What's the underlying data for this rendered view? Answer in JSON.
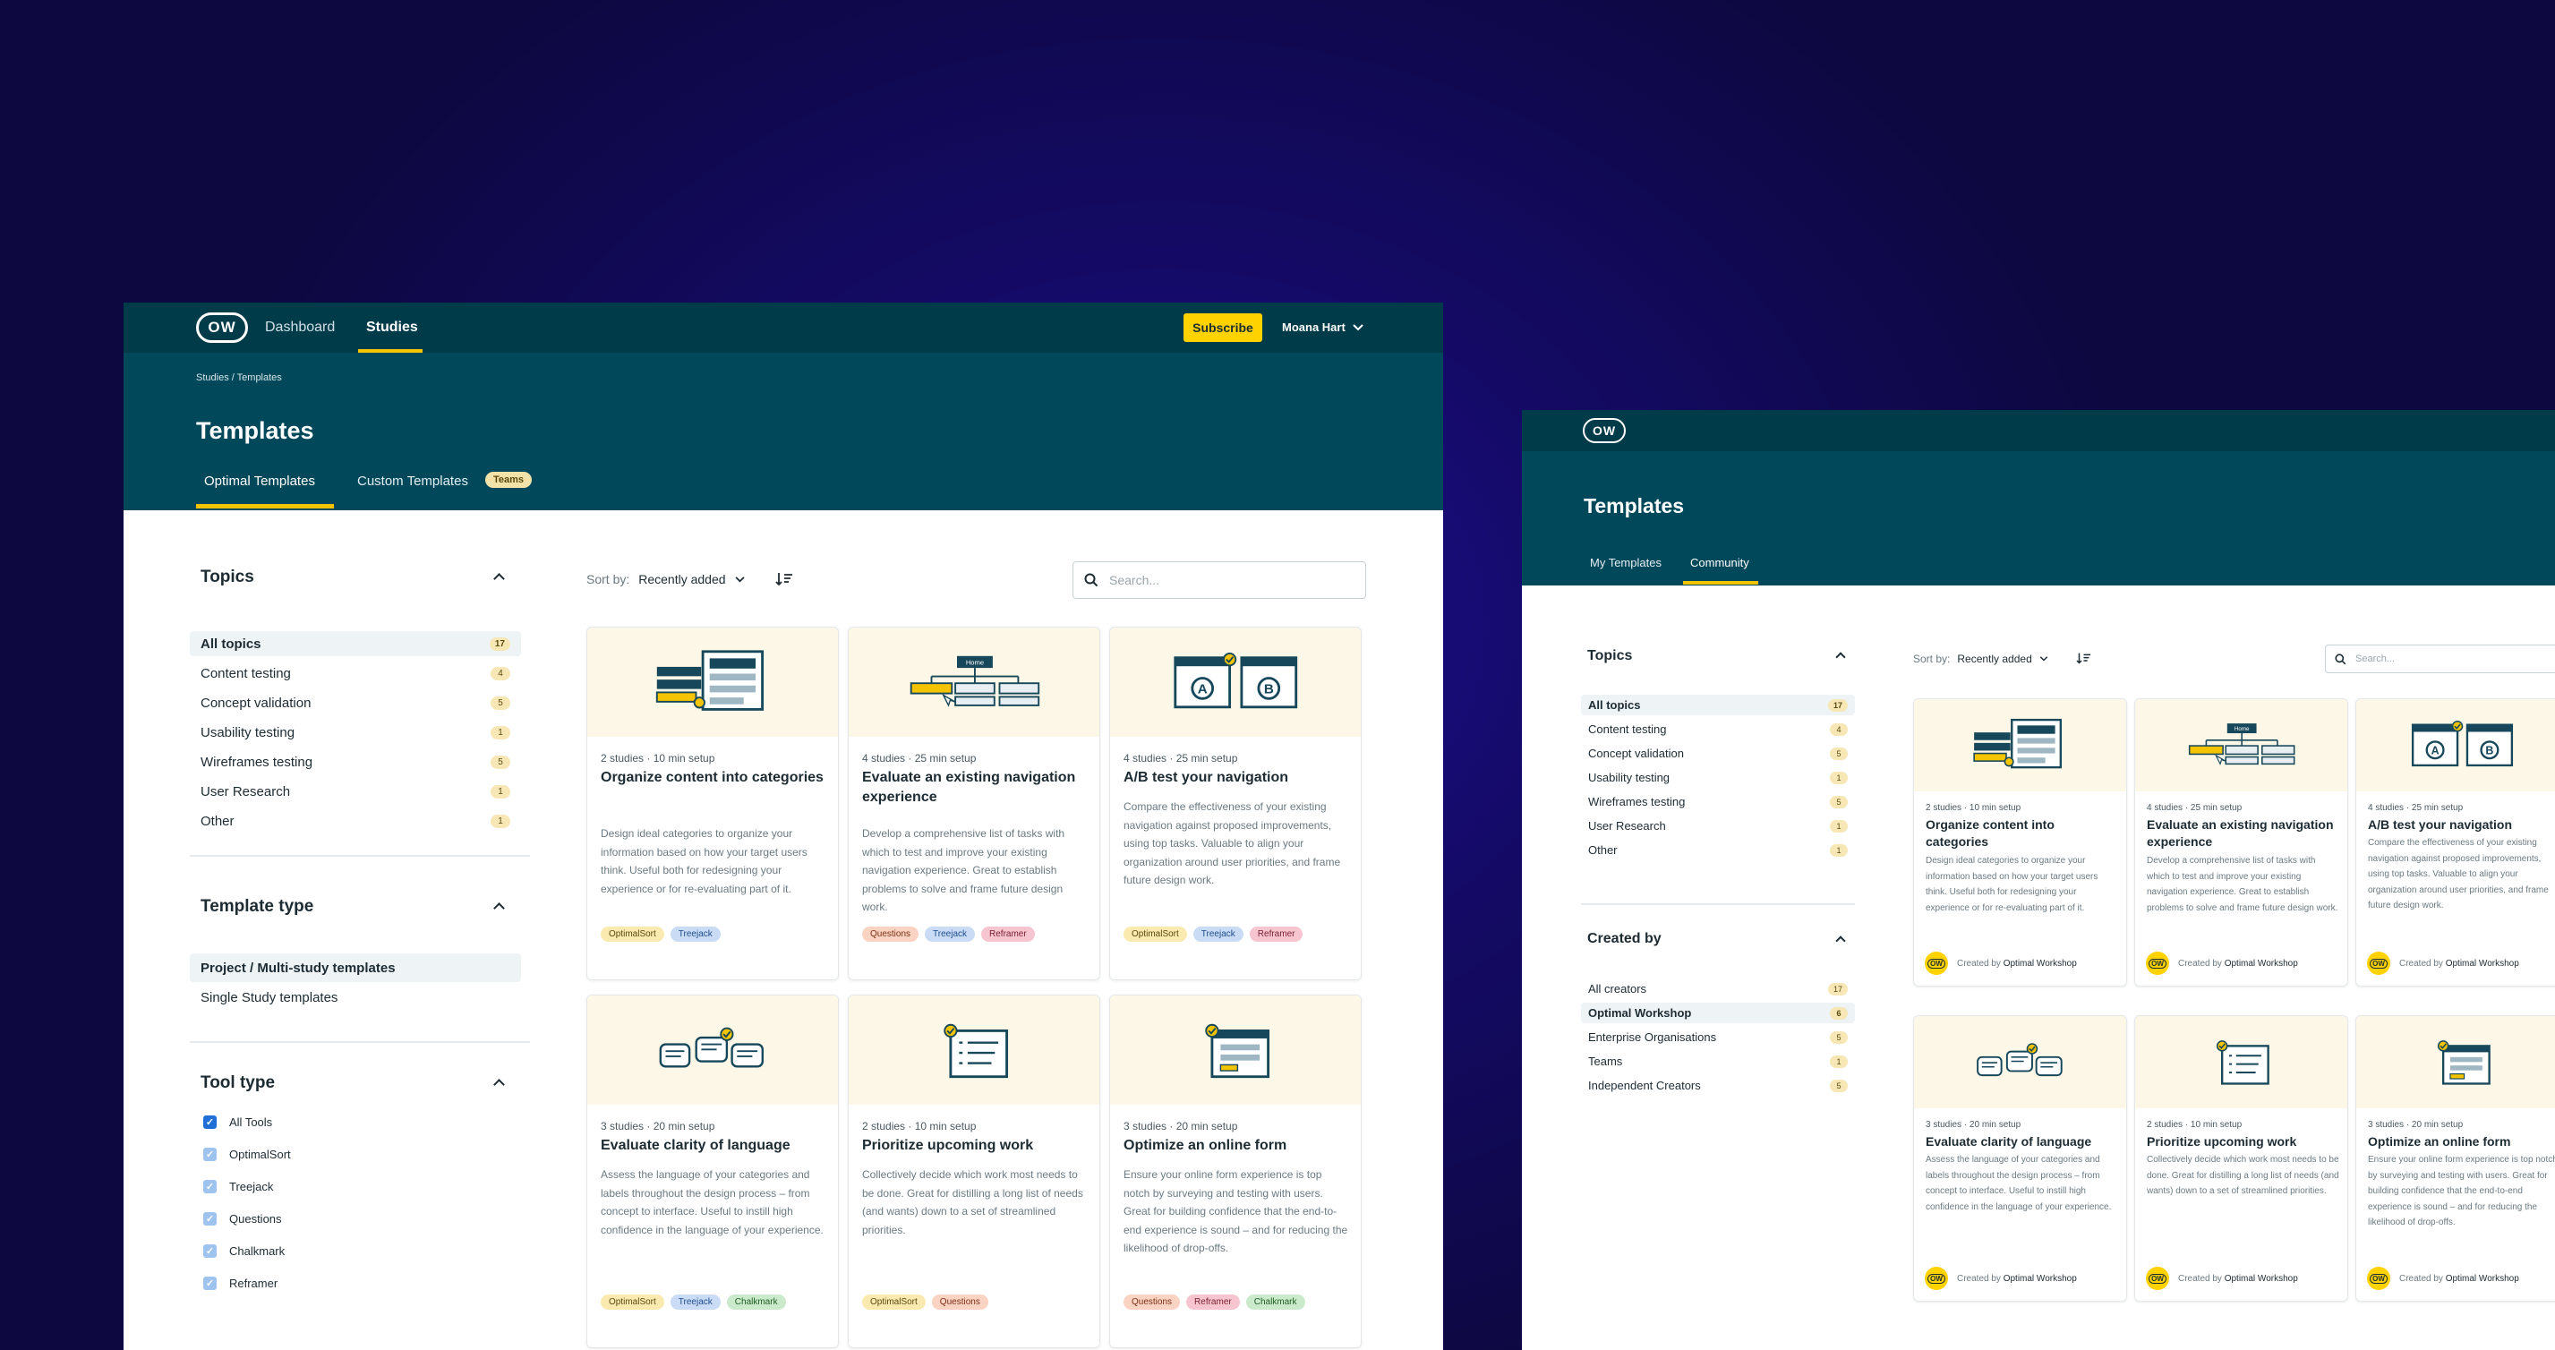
{
  "main_window": {
    "logo": "OW",
    "nav": {
      "dashboard": "Dashboard",
      "studies": "Studies"
    },
    "subscribe_label": "Subscribe",
    "user_name": "Moana Hart",
    "breadcrumb": "Studies / Templates",
    "page_title": "Templates",
    "tabs": {
      "optimal": "Optimal Templates",
      "custom": "Custom Templates",
      "custom_badge": "Teams"
    },
    "sidebar": {
      "topics_title": "Topics",
      "topics": [
        {
          "label": "All topics",
          "count": "17"
        },
        {
          "label": "Content testing",
          "count": "4"
        },
        {
          "label": "Concept validation",
          "count": "5"
        },
        {
          "label": "Usability testing",
          "count": "1"
        },
        {
          "label": "Wireframes testing",
          "count": "5"
        },
        {
          "label": "User Research",
          "count": "1"
        },
        {
          "label": "Other",
          "count": "1"
        }
      ],
      "template_type_title": "Template type",
      "template_types": [
        "Project / Multi-study templates",
        "Single Study templates"
      ],
      "tool_type_title": "Tool type",
      "tools": [
        "All Tools",
        "OptimalSort",
        "Treejack",
        "Questions",
        "Chalkmark",
        "Reframer"
      ]
    },
    "sort": {
      "label": "Sort by:",
      "value": "Recently added"
    },
    "search_placeholder": "Search...",
    "cards": [
      {
        "meta": "2 studies · 10 min setup",
        "title": "Organize content into categories",
        "desc": "Design ideal categories to organize your information based on how your target users think. Useful both for redesigning your experience or for re-evaluating part of it.",
        "tags": [
          "OptimalSort",
          "Treejack"
        ]
      },
      {
        "meta": "4 studies · 25 min setup",
        "title": "Evaluate an existing navigation experience",
        "desc": "Develop a comprehensive list of tasks with which to test and improve your existing navigation experience. Great to establish problems to solve and frame future design work.",
        "tags": [
          "Questions",
          "Treejack",
          "Reframer"
        ]
      },
      {
        "meta": "4 studies · 25 min setup",
        "title": "A/B test your navigation",
        "desc": "Compare the effectiveness of your existing navigation against proposed improvements, using top tasks. Valuable to align your organization around user priorities, and frame future design work.",
        "tags": [
          "OptimalSort",
          "Treejack",
          "Reframer"
        ]
      },
      {
        "meta": "3 studies · 20 min setup",
        "title": "Evaluate clarity of language",
        "desc": "Assess the language of your categories and labels throughout the design process – from concept to interface. Useful to instill high confidence in the language of your experience.",
        "tags": [
          "OptimalSort",
          "Treejack",
          "Chalkmark"
        ]
      },
      {
        "meta": "2 studies · 10 min setup",
        "title": "Prioritize upcoming work",
        "desc": "Collectively decide which work most needs to be done. Great for distilling a long list of needs (and wants) down to a set of streamlined priorities.",
        "tags": [
          "OptimalSort",
          "Questions"
        ]
      },
      {
        "meta": "3 studies · 20 min setup",
        "title": "Optimize an online form",
        "desc": "Ensure your online form experience is top notch by surveying and testing with users. Great for building confidence that the end-to-end experience is sound – and for reducing the likelihood of drop-offs.",
        "tags": [
          "Questions",
          "Reframer",
          "Chalkmark"
        ]
      }
    ]
  },
  "community_window": {
    "logo": "OW",
    "page_title": "Templates",
    "tabs": {
      "my": "My Templates",
      "community": "Community"
    },
    "sidebar": {
      "topics_title": "Topics",
      "topics": [
        {
          "label": "All topics",
          "count": "17"
        },
        {
          "label": "Content testing",
          "count": "4"
        },
        {
          "label": "Concept validation",
          "count": "5"
        },
        {
          "label": "Usability testing",
          "count": "1"
        },
        {
          "label": "Wireframes testing",
          "count": "5"
        },
        {
          "label": "User Research",
          "count": "1"
        },
        {
          "label": "Other",
          "count": "1"
        }
      ],
      "created_by_title": "Created by",
      "creators": [
        {
          "label": "All creators",
          "count": "17"
        },
        {
          "label": "Optimal Workshop",
          "count": "6"
        },
        {
          "label": "Enterprise Organisations",
          "count": "5"
        },
        {
          "label": "Teams",
          "count": "1"
        },
        {
          "label": "Independent Creators",
          "count": "5"
        }
      ]
    },
    "sort": {
      "label": "Sort by:",
      "value": "Recently added"
    },
    "search_placeholder": "Search...",
    "creator_prefix": "Created by",
    "creator_name": "Optimal Workshop",
    "badge_text": "OW",
    "cards": [
      {
        "meta": "2 studies · 10 min setup",
        "title": "Organize content into categories",
        "desc": "Design ideal categories to organize your information based on how your target users think. Useful both for redesigning your experience or for re-evaluating part of it."
      },
      {
        "meta": "4 studies · 25 min setup",
        "title": "Evaluate an existing navigation experience",
        "desc": "Develop a comprehensive list of tasks with which to test and improve your existing navigation experience. Great to establish problems to solve and frame future design work."
      },
      {
        "meta": "4 studies · 25 min setup",
        "title": "A/B test your navigation",
        "desc": "Compare the effectiveness of your existing navigation against proposed improvements, using top tasks. Valuable to align your organization around user priorities, and frame future design work."
      },
      {
        "meta": "3 studies · 20 min setup",
        "title": "Evaluate clarity of language",
        "desc": "Assess the language of your categories and labels throughout the design process – from concept to interface. Useful to instill high confidence in the language of your experience."
      },
      {
        "meta": "2 studies · 10 min setup",
        "title": "Prioritize upcoming work",
        "desc": "Collectively decide which work most needs to be done. Great for distilling a long list of needs (and wants) down to a set of streamlined priorities."
      },
      {
        "meta": "3 studies · 20 min setup",
        "title": "Optimize an online form",
        "desc": "Ensure your online form experience is top notch by surveying and testing with users. Great for building confidence that the end-to-end experience is sound – and for reducing the likelihood of drop-offs."
      }
    ]
  },
  "colors": {
    "header_dark": "#003b4a",
    "header": "#00485a",
    "accent": "#f5c400",
    "subscribe": "#ffd200"
  }
}
